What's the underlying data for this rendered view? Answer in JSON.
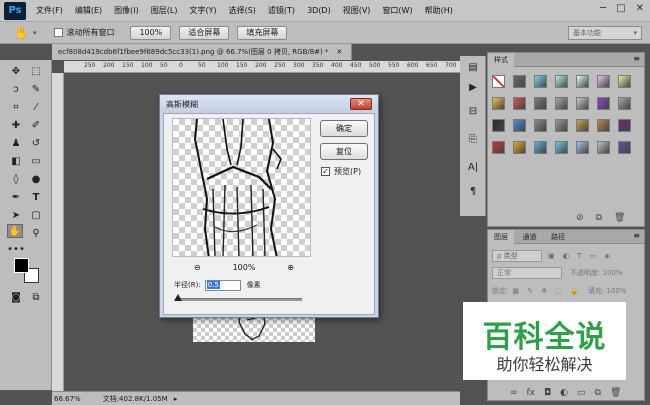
{
  "app": {
    "logo": "Ps"
  },
  "menubar": {
    "items": [
      "文件(F)",
      "编辑(E)",
      "图像(I)",
      "图层(L)",
      "文字(Y)",
      "选择(S)",
      "滤镜(T)",
      "3D(D)",
      "视图(V)",
      "窗口(W)",
      "帮助(H)"
    ],
    "window_controls": [
      "─",
      "□",
      "✕"
    ]
  },
  "options_bar": {
    "scroll_all_label": "滚动所有窗口",
    "zoom_button": "100%",
    "fit_screen_button": "适合屏幕",
    "fill_screen_button": "填充屏幕",
    "workspace": "基本功能"
  },
  "document": {
    "tab_title": "ecf808d419cdb6f1fbee9f689dc5cc33(1).png @ 66.7%(图层 0 拷贝, RGB/8#) *",
    "ruler_ticks": [
      "250",
      "200",
      "150",
      "100",
      "50",
      "0",
      "50",
      "100",
      "150",
      "200",
      "250",
      "300",
      "350",
      "400",
      "450",
      "500",
      "550",
      "600",
      "650",
      "700",
      "750"
    ]
  },
  "status_bar": {
    "zoom": "66.67%",
    "doc_info": "文档:402.8K/1.05M"
  },
  "dialog": {
    "title": "高斯模糊",
    "ok_button": "确定",
    "reset_button": "复位",
    "preview_label": "预览(P)",
    "preview_checked": true,
    "zoom_level": "100%",
    "radius_label": "半径(R):",
    "radius_value": "0.5",
    "radius_unit": "像素",
    "radius_slider_fraction": 0.0
  },
  "styles_panel": {
    "tab": "样式"
  },
  "layers_panel": {
    "tabs": [
      "图层",
      "通道",
      "路径"
    ],
    "filter_label": "ρ 类型",
    "blend_mode": "正常",
    "opacity_label": "不透明度: 100%",
    "lock_label": "锁定:",
    "fill_label": "填充: 100%"
  },
  "watermark": {
    "title": "百科全说",
    "subtitle": "助你轻松解决"
  },
  "colors": {
    "brand_green": "#2ea04a",
    "ps_blue": "#30a8ff",
    "close_red": "#c4412f"
  }
}
